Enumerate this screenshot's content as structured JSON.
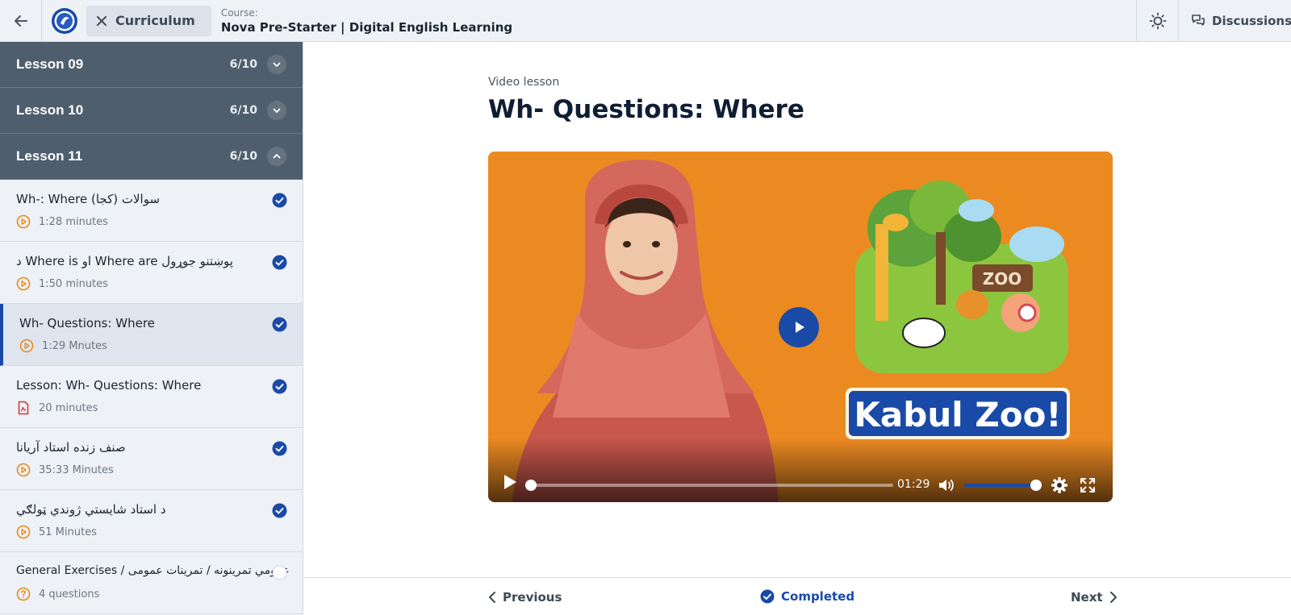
{
  "topbar": {
    "curriculum_label": "Curriculum",
    "course_kicker": "Course:",
    "course_title": "Nova Pre-Starter | Digital English Learning",
    "discussions_label": "Discussions"
  },
  "sidebar": {
    "lessons": [
      {
        "name": "Lesson 09",
        "count": "6/10",
        "expanded": false
      },
      {
        "name": "Lesson 10",
        "count": "6/10",
        "expanded": false
      },
      {
        "name": "Lesson 11",
        "count": "6/10",
        "expanded": true
      }
    ],
    "items": [
      {
        "title": "Wh-: Where (کجا) سوالات",
        "duration": "1:28 minutes",
        "type": "video",
        "completed": true
      },
      {
        "title": "د Where is او Where are پوښتنو جوړول",
        "duration": "1:50 minutes",
        "type": "video",
        "completed": true
      },
      {
        "title": "Wh- Questions: Where",
        "duration": "1:29 Mnutes",
        "type": "video",
        "completed": true
      },
      {
        "title": "Lesson: Wh- Questions: Where",
        "duration": "20 minutes",
        "type": "pdf",
        "completed": true
      },
      {
        "title": "صنف زنده استاد آریانا",
        "duration": "35:33 Minutes",
        "type": "video",
        "completed": true
      },
      {
        "title": "د استاد شایستي ژوندي ټولګي",
        "duration": "51 Minutes",
        "type": "video",
        "completed": true
      },
      {
        "title": "General Exercises / عمومي تمرینونه / تمرینات عمومی",
        "duration": "4 questions",
        "type": "quiz",
        "completed": false
      }
    ]
  },
  "main": {
    "kicker": "Video lesson",
    "title": "Wh- Questions: Where",
    "video": {
      "poster_text": "Kabul Zoo!",
      "sign_text": "ZOO",
      "time": "01:29",
      "progress": 0,
      "volume": 1.0
    },
    "footer": {
      "previous_label": "Previous",
      "completed_label": "Completed",
      "next_label": "Next"
    }
  },
  "colors": {
    "accent": "#1a4aa8",
    "lesson_header": "#4f5e6d",
    "video_bg": "#ec8a22",
    "duration_icon": "#e8891c",
    "pdf_icon": "#d63a3a"
  }
}
